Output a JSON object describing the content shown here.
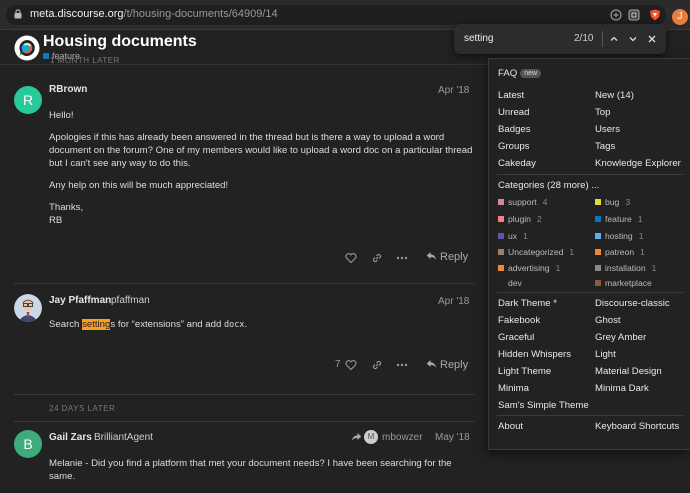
{
  "browser": {
    "url_host": "meta.discourse.org",
    "url_path": "/t/housing-documents/64909/14",
    "profile_initial": "J"
  },
  "findbar": {
    "query": "setting",
    "count": "2/10"
  },
  "topic": {
    "title": "Housing documents",
    "category": "feature",
    "category_color": "#0e76bd"
  },
  "time_gap_top": "1 MONTH LATER",
  "posts": [
    {
      "avatar_letter": "R",
      "avatar_color": "#27c99a",
      "name": "RBrown",
      "date": "Apr '18",
      "paragraphs": [
        "Hello!",
        "Apologies if this has already been answered in the thread but is there a way to upload a word document on the forum? One of my members would like to upload a word doc on a particular thread but I can't see any way to do this.",
        "Any help on this will be much appreciated!"
      ],
      "signoff_1": "Thanks,",
      "signoff_2": "RB",
      "reply_label": "Reply"
    },
    {
      "name": "Jay Pfaffman",
      "username": "pfaffman",
      "date": "Apr '18",
      "body_before": "Search ",
      "body_highlight": "setting",
      "body_middle": "s for “extensions” and add ",
      "body_code": "docx",
      "body_after": ".",
      "likes": "7",
      "reply_label": "Reply"
    },
    {
      "avatar_letter": "B",
      "avatar_color": "#3dab7b",
      "name": "Gail Zars",
      "username": "BrilliantAgent",
      "reply_to_initial": "M",
      "reply_to": "mbowzer",
      "date": "May '18",
      "body": "Melanie - Did you find a platform that met your document needs? I have been searching for the same."
    }
  ],
  "time_gap_bottom": "24 DAYS LATER",
  "menu": {
    "faq": "FAQ",
    "faq_badge": "new",
    "nav_left": [
      "Latest",
      "Unread",
      "Badges",
      "Groups",
      "Cakeday"
    ],
    "nav_right": [
      "New (14)",
      "Top",
      "Users",
      "Tags",
      "Knowledge Explorer"
    ],
    "categories_header": "Categories (28 more) ...",
    "categories_left": [
      {
        "name": "support",
        "count": "4",
        "color": "#ce8a9c"
      },
      {
        "name": "plugin",
        "count": "2",
        "color": "#f0847d"
      },
      {
        "name": "ux",
        "count": "1",
        "color": "#6b4fa0"
      },
      {
        "name": "Uncategorized",
        "count": "1",
        "color": "#a08060"
      },
      {
        "name": "advertising",
        "count": "1",
        "color": "#e8893c"
      },
      {
        "name": "dev",
        "count": "",
        "color": "#222222"
      }
    ],
    "categories_right": [
      {
        "name": "bug",
        "count": "3",
        "color": "#e8d63a"
      },
      {
        "name": "feature",
        "count": "1",
        "color": "#0e76bd"
      },
      {
        "name": "hosting",
        "count": "1",
        "color": "#5ab0e8"
      },
      {
        "name": "patreon",
        "count": "1",
        "color": "#e8893c"
      },
      {
        "name": "installation",
        "count": "1",
        "color": "#8a8a8a"
      },
      {
        "name": "marketplace",
        "count": "",
        "color": "#8a5a3a"
      }
    ],
    "themes_left": [
      "Dark Theme *",
      "Fakebook",
      "Graceful",
      "Hidden Whispers",
      "Light Theme",
      "Minima",
      "Sam's Simple Theme"
    ],
    "themes_right": [
      "Discourse-classic",
      "Ghost",
      "Grey Amber",
      "Light",
      "Material Design",
      "Minima Dark"
    ],
    "about": "About",
    "shortcuts": "Keyboard Shortcuts"
  }
}
